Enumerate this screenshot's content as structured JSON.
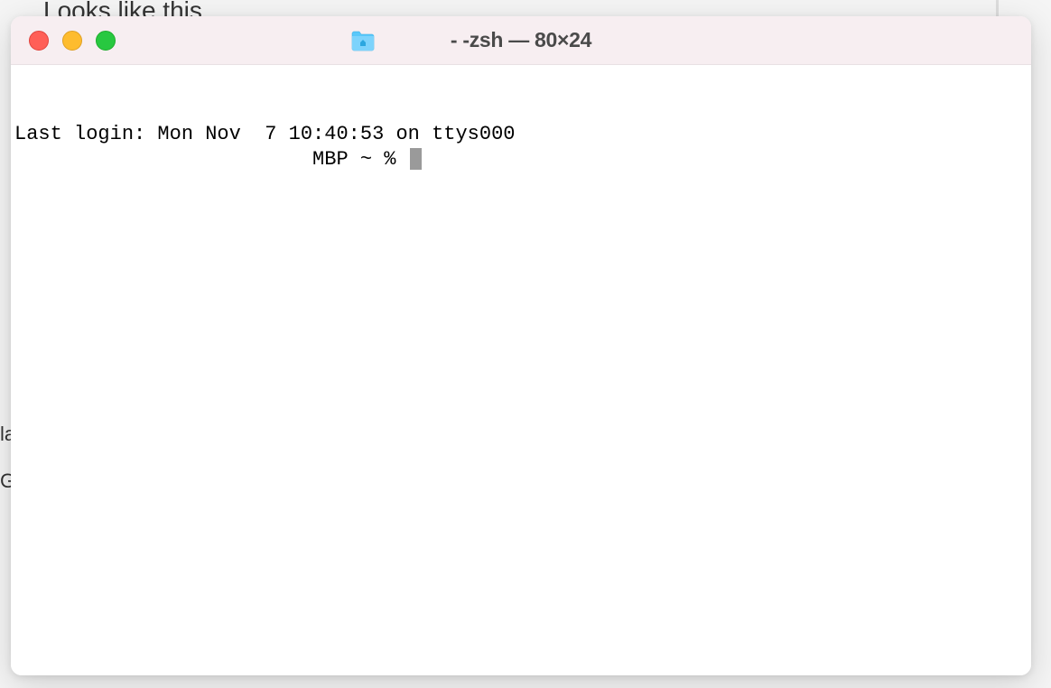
{
  "background": {
    "partial_text_top": "Looks like this",
    "fragment_left_1": "la",
    "fragment_left_2": "Gi"
  },
  "window": {
    "title": "- -zsh — 80×24",
    "traffic_lights": {
      "close": "close",
      "minimize": "minimize",
      "zoom": "zoom"
    },
    "proxy_icon": "home-folder-icon"
  },
  "terminal": {
    "last_login_line": "Last login: Mon Nov  7 10:40:53 on ttys000",
    "prompt_prefix": "                         MBP ~ % "
  }
}
